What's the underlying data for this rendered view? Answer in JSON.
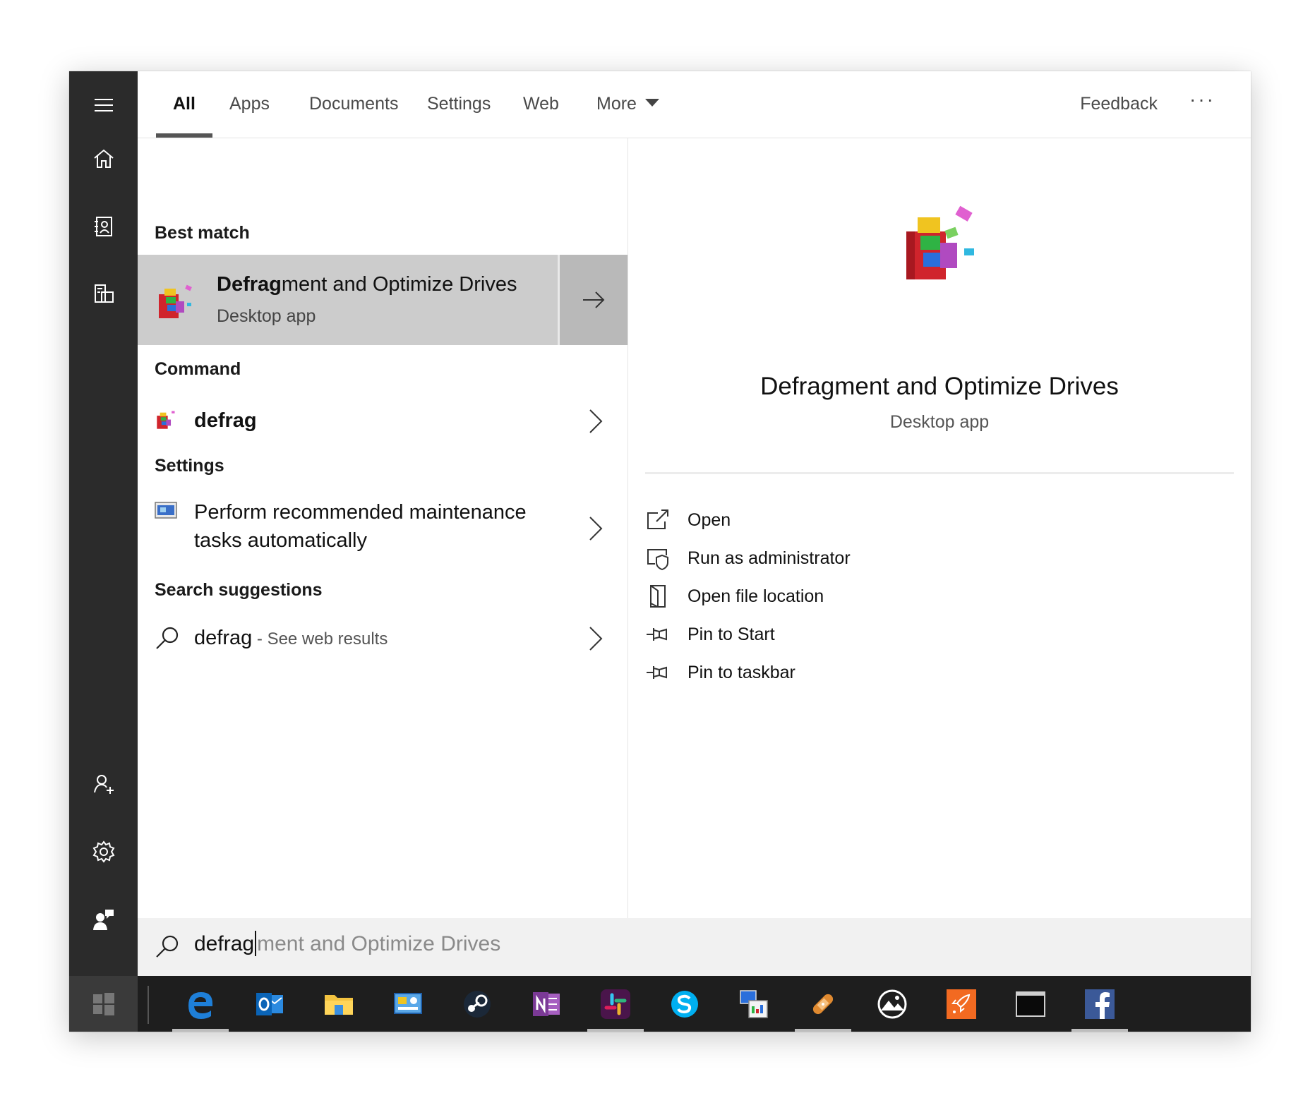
{
  "tabs": [
    {
      "label": "All"
    },
    {
      "label": "Apps"
    },
    {
      "label": "Documents"
    },
    {
      "label": "Settings"
    },
    {
      "label": "Web"
    },
    {
      "label": "More"
    }
  ],
  "header": {
    "feedback": "Feedback",
    "more_options": "···"
  },
  "rail": {
    "icons": [
      "hamburger-icon",
      "home-icon",
      "notebook-icon",
      "devices-icon",
      "add-user-icon",
      "gear-icon",
      "feedback-person-icon"
    ]
  },
  "best_match": {
    "heading": "Best match",
    "title_bold": "Defrag",
    "title_rest": "ment and Optimize Drives",
    "subtitle": "Desktop app"
  },
  "command": {
    "heading": "Command",
    "item": "defrag"
  },
  "settings": {
    "heading": "Settings",
    "line1": "Perform recommended maintenance",
    "line2": "tasks automatically"
  },
  "suggestions": {
    "heading": "Search suggestions",
    "query": "defrag",
    "hint": " - See web results"
  },
  "preview": {
    "title": "Defragment and Optimize Drives",
    "subtitle": "Desktop app",
    "actions": [
      {
        "label": "Open",
        "icon": "open-icon"
      },
      {
        "label": "Run as administrator",
        "icon": "shield-icon"
      },
      {
        "label": "Open file location",
        "icon": "file-location-icon"
      },
      {
        "label": "Pin to Start",
        "icon": "pin-icon"
      },
      {
        "label": "Pin to taskbar",
        "icon": "pin-icon"
      }
    ]
  },
  "search": {
    "typed": "defrag",
    "completion": "ment and Optimize Drives"
  },
  "taskbar": {
    "apps": [
      "edge",
      "outlook",
      "file-explorer",
      "control-panel",
      "steam",
      "onenote",
      "slack",
      "skype",
      "remote-desktop",
      "bandage-app",
      "zoner-photo",
      "rocket-app",
      "terminal",
      "facebook"
    ],
    "colors": {
      "edge": "#1e7fd8",
      "outlook": "#0a64b7",
      "onenote": "#7b3a96",
      "slack": "#4a154b",
      "skype": "#00aff0",
      "facebook": "#3b5998",
      "rocket": "#f26a21"
    }
  }
}
